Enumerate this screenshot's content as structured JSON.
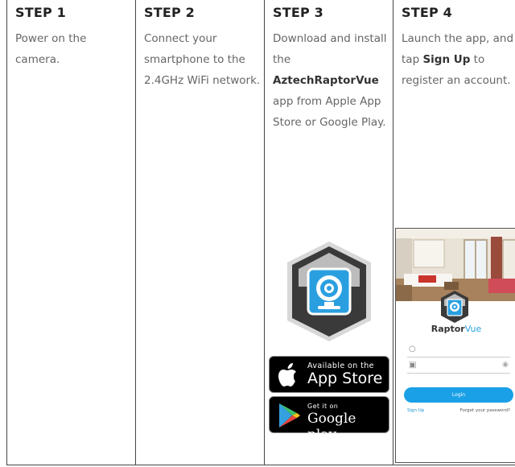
{
  "steps": [
    {
      "title": "STEP 1",
      "body": "Power on the camera."
    },
    {
      "title": "STEP 2",
      "body": "Connect your smartphone to the 2.4GHz WiFi network."
    },
    {
      "title": "STEP 3",
      "body_pre": "Download and install the ",
      "body_bold": "AztechRaptorVue",
      "body_post": " app from Apple App Store or Google Play."
    },
    {
      "title": "STEP 4",
      "body_pre": "Launch the app, and tap ",
      "body_bold": "Sign Up",
      "body_post": " to register an account."
    }
  ],
  "app_store_badge": {
    "small": "Available on the",
    "big": "App Store",
    "icon": "apple-icon"
  },
  "google_play_badge": {
    "small": "Get it on",
    "big": "Google play",
    "icon": "google-play-icon"
  },
  "phone": {
    "brand_bold": "Raptor",
    "brand_light": "Vue",
    "login_label": "Login",
    "signup_label": "Sign Up",
    "forgot_label": "Forget your password?",
    "user_icon": "user-icon",
    "lock_icon": "lock-icon",
    "eye_icon": "eye-icon"
  },
  "colors": {
    "accent": "#1aa0e6",
    "icon_blue": "#2a9fe0",
    "icon_dark": "#3a3a3a"
  }
}
